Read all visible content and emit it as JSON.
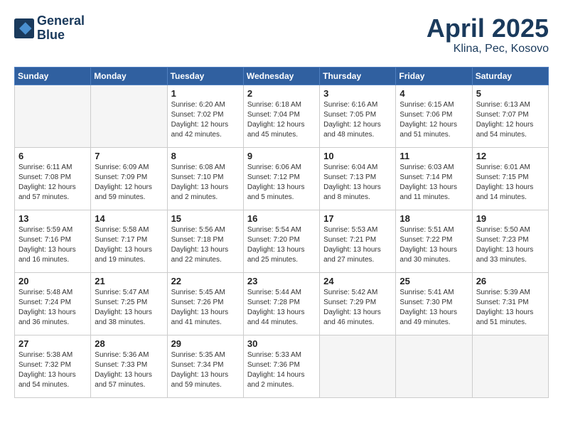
{
  "header": {
    "logo_line1": "General",
    "logo_line2": "Blue",
    "title": "April 2025",
    "location": "Klina, Pec, Kosovo"
  },
  "days_of_week": [
    "Sunday",
    "Monday",
    "Tuesday",
    "Wednesday",
    "Thursday",
    "Friday",
    "Saturday"
  ],
  "weeks": [
    [
      {
        "day": "",
        "info": ""
      },
      {
        "day": "",
        "info": ""
      },
      {
        "day": "1",
        "info": "Sunrise: 6:20 AM\nSunset: 7:02 PM\nDaylight: 12 hours\nand 42 minutes."
      },
      {
        "day": "2",
        "info": "Sunrise: 6:18 AM\nSunset: 7:04 PM\nDaylight: 12 hours\nand 45 minutes."
      },
      {
        "day": "3",
        "info": "Sunrise: 6:16 AM\nSunset: 7:05 PM\nDaylight: 12 hours\nand 48 minutes."
      },
      {
        "day": "4",
        "info": "Sunrise: 6:15 AM\nSunset: 7:06 PM\nDaylight: 12 hours\nand 51 minutes."
      },
      {
        "day": "5",
        "info": "Sunrise: 6:13 AM\nSunset: 7:07 PM\nDaylight: 12 hours\nand 54 minutes."
      }
    ],
    [
      {
        "day": "6",
        "info": "Sunrise: 6:11 AM\nSunset: 7:08 PM\nDaylight: 12 hours\nand 57 minutes."
      },
      {
        "day": "7",
        "info": "Sunrise: 6:09 AM\nSunset: 7:09 PM\nDaylight: 12 hours\nand 59 minutes."
      },
      {
        "day": "8",
        "info": "Sunrise: 6:08 AM\nSunset: 7:10 PM\nDaylight: 13 hours\nand 2 minutes."
      },
      {
        "day": "9",
        "info": "Sunrise: 6:06 AM\nSunset: 7:12 PM\nDaylight: 13 hours\nand 5 minutes."
      },
      {
        "day": "10",
        "info": "Sunrise: 6:04 AM\nSunset: 7:13 PM\nDaylight: 13 hours\nand 8 minutes."
      },
      {
        "day": "11",
        "info": "Sunrise: 6:03 AM\nSunset: 7:14 PM\nDaylight: 13 hours\nand 11 minutes."
      },
      {
        "day": "12",
        "info": "Sunrise: 6:01 AM\nSunset: 7:15 PM\nDaylight: 13 hours\nand 14 minutes."
      }
    ],
    [
      {
        "day": "13",
        "info": "Sunrise: 5:59 AM\nSunset: 7:16 PM\nDaylight: 13 hours\nand 16 minutes."
      },
      {
        "day": "14",
        "info": "Sunrise: 5:58 AM\nSunset: 7:17 PM\nDaylight: 13 hours\nand 19 minutes."
      },
      {
        "day": "15",
        "info": "Sunrise: 5:56 AM\nSunset: 7:18 PM\nDaylight: 13 hours\nand 22 minutes."
      },
      {
        "day": "16",
        "info": "Sunrise: 5:54 AM\nSunset: 7:20 PM\nDaylight: 13 hours\nand 25 minutes."
      },
      {
        "day": "17",
        "info": "Sunrise: 5:53 AM\nSunset: 7:21 PM\nDaylight: 13 hours\nand 27 minutes."
      },
      {
        "day": "18",
        "info": "Sunrise: 5:51 AM\nSunset: 7:22 PM\nDaylight: 13 hours\nand 30 minutes."
      },
      {
        "day": "19",
        "info": "Sunrise: 5:50 AM\nSunset: 7:23 PM\nDaylight: 13 hours\nand 33 minutes."
      }
    ],
    [
      {
        "day": "20",
        "info": "Sunrise: 5:48 AM\nSunset: 7:24 PM\nDaylight: 13 hours\nand 36 minutes."
      },
      {
        "day": "21",
        "info": "Sunrise: 5:47 AM\nSunset: 7:25 PM\nDaylight: 13 hours\nand 38 minutes."
      },
      {
        "day": "22",
        "info": "Sunrise: 5:45 AM\nSunset: 7:26 PM\nDaylight: 13 hours\nand 41 minutes."
      },
      {
        "day": "23",
        "info": "Sunrise: 5:44 AM\nSunset: 7:28 PM\nDaylight: 13 hours\nand 44 minutes."
      },
      {
        "day": "24",
        "info": "Sunrise: 5:42 AM\nSunset: 7:29 PM\nDaylight: 13 hours\nand 46 minutes."
      },
      {
        "day": "25",
        "info": "Sunrise: 5:41 AM\nSunset: 7:30 PM\nDaylight: 13 hours\nand 49 minutes."
      },
      {
        "day": "26",
        "info": "Sunrise: 5:39 AM\nSunset: 7:31 PM\nDaylight: 13 hours\nand 51 minutes."
      }
    ],
    [
      {
        "day": "27",
        "info": "Sunrise: 5:38 AM\nSunset: 7:32 PM\nDaylight: 13 hours\nand 54 minutes."
      },
      {
        "day": "28",
        "info": "Sunrise: 5:36 AM\nSunset: 7:33 PM\nDaylight: 13 hours\nand 57 minutes."
      },
      {
        "day": "29",
        "info": "Sunrise: 5:35 AM\nSunset: 7:34 PM\nDaylight: 13 hours\nand 59 minutes."
      },
      {
        "day": "30",
        "info": "Sunrise: 5:33 AM\nSunset: 7:36 PM\nDaylight: 14 hours\nand 2 minutes."
      },
      {
        "day": "",
        "info": ""
      },
      {
        "day": "",
        "info": ""
      },
      {
        "day": "",
        "info": ""
      }
    ]
  ]
}
